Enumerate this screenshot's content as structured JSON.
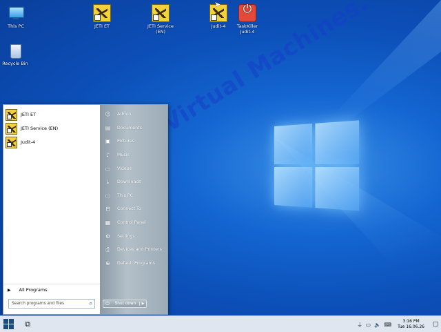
{
  "desktop": {
    "icons": [
      {
        "label": "This PC",
        "icon": "computer-icon"
      },
      {
        "label": "Recycle Bin",
        "icon": "recycle-bin-icon"
      },
      {
        "label": "JETI ET",
        "icon": "jeti-app-icon"
      },
      {
        "label": "JETI Service (EN)",
        "icon": "jeti-app-icon"
      },
      {
        "label": "Judit-4",
        "icon": "jeti-app-icon"
      },
      {
        "label": "TaskKiller Judit-4",
        "icon": "power-icon"
      }
    ],
    "watermark": "RJ-R Virtual Machines."
  },
  "start_menu": {
    "pinned": [
      {
        "label": "JETI ET"
      },
      {
        "label": "JETI Service (EN)"
      },
      {
        "label": "Judit-4"
      }
    ],
    "all_programs": "All Programs",
    "search_placeholder": "Search programs and files",
    "right_items": [
      {
        "label": "Admin",
        "icon": "user-icon"
      },
      {
        "label": "Documents",
        "icon": "document-icon"
      },
      {
        "label": "Pictures",
        "icon": "pictures-icon"
      },
      {
        "label": "Music",
        "icon": "music-icon"
      },
      {
        "label": "Videos",
        "icon": "video-icon"
      },
      {
        "label": "Downloads",
        "icon": "download-icon"
      },
      {
        "label": "This PC",
        "icon": "computer-icon"
      },
      {
        "label": "Connect To",
        "icon": "network-icon"
      },
      {
        "label": "Control Panel",
        "icon": "control-panel-icon"
      },
      {
        "label": "Settings",
        "icon": "gear-icon"
      },
      {
        "label": "Devices and Printers",
        "icon": "printer-icon"
      },
      {
        "label": "Default Programs",
        "icon": "globe-icon"
      }
    ],
    "shutdown_label": "Shut down"
  },
  "taskbar": {
    "time": "3:16 PM",
    "date": "Tue 16.06.26"
  }
}
